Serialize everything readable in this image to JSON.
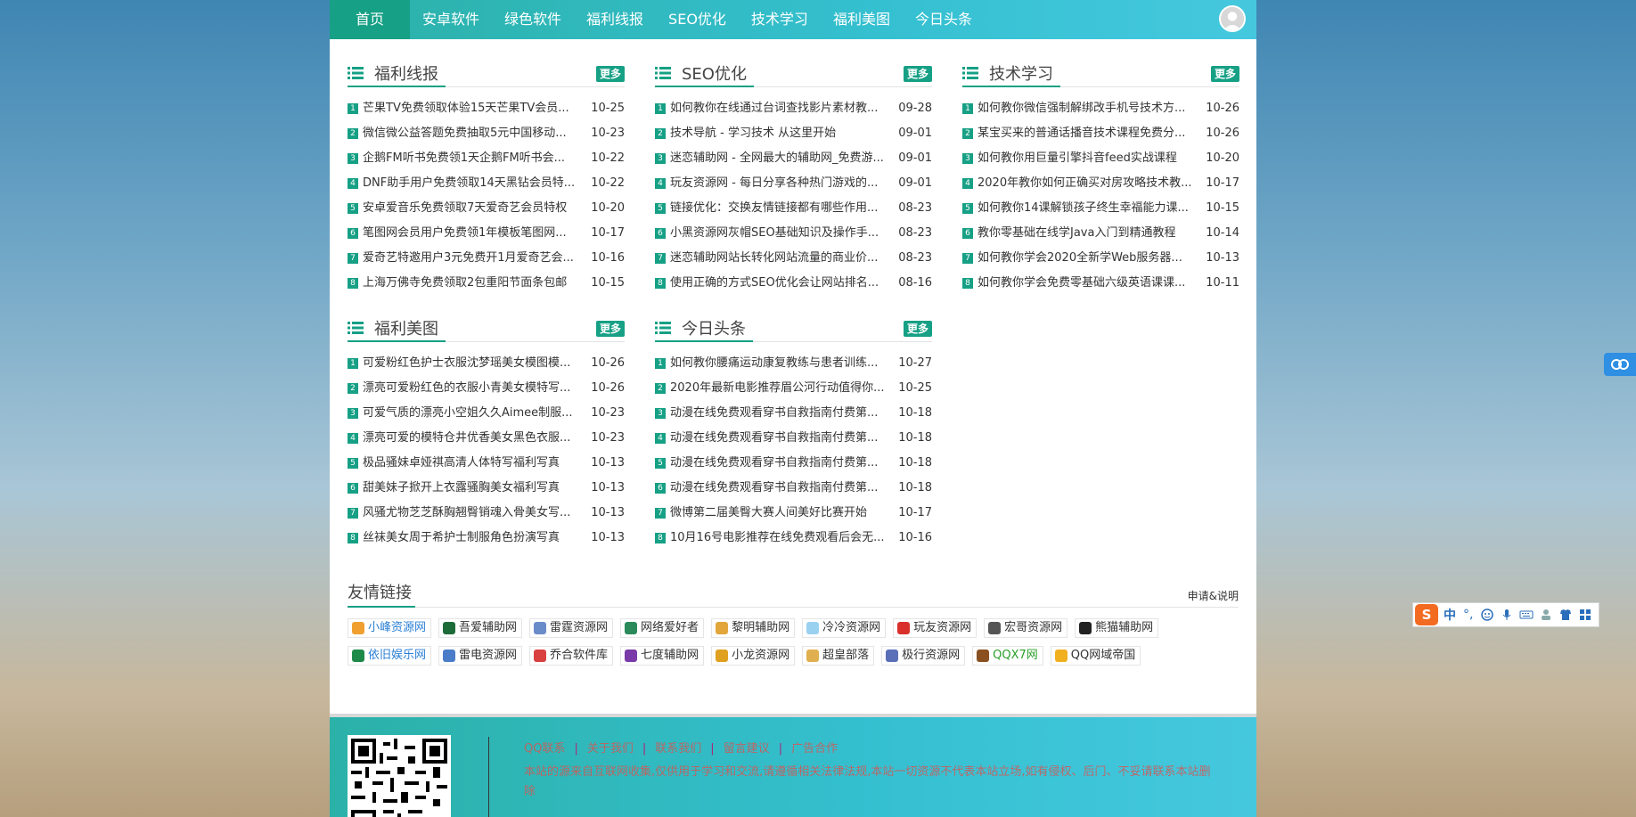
{
  "nav": {
    "items": [
      {
        "label": "首页",
        "active": true
      },
      {
        "label": "安卓软件"
      },
      {
        "label": "绿色软件"
      },
      {
        "label": "福利线报"
      },
      {
        "label": "SEO优化"
      },
      {
        "label": "技术学习"
      },
      {
        "label": "福利美图"
      },
      {
        "label": "今日头条"
      }
    ]
  },
  "blocks": [
    {
      "title": "福利线报",
      "more": "更多",
      "items": [
        {
          "n": "1",
          "title": "芒果TV免费领取体验15天芒果TV会员...",
          "date": "10-25"
        },
        {
          "n": "2",
          "title": "微信微公益答题免费抽取5元中国移动...",
          "date": "10-23"
        },
        {
          "n": "3",
          "title": "企鹅FM听书免费领1天企鹅FM听书会...",
          "date": "10-22"
        },
        {
          "n": "4",
          "title": "DNF助手用户免费领取14天黑钻会员特...",
          "date": "10-22"
        },
        {
          "n": "5",
          "title": "安卓爱音乐免费领取7天爱奇艺会员特权",
          "date": "10-20"
        },
        {
          "n": "6",
          "title": "笔图网会员用户免费领1年模板笔图网...",
          "date": "10-17"
        },
        {
          "n": "7",
          "title": "爱奇艺特邀用户3元免费开1月爱奇艺会...",
          "date": "10-16"
        },
        {
          "n": "8",
          "title": "上海万佛寺免费领取2包重阳节面条包邮",
          "date": "10-15"
        }
      ]
    },
    {
      "title": "SEO优化",
      "more": "更多",
      "items": [
        {
          "n": "1",
          "title": "如何教你在线通过台词查找影片素材教...",
          "date": "09-28"
        },
        {
          "n": "2",
          "title": "技术导航 - 学习技术 从这里开始",
          "date": "09-01"
        },
        {
          "n": "3",
          "title": "迷恋辅助网 - 全网最大的辅助网_免费游...",
          "date": "09-01"
        },
        {
          "n": "4",
          "title": "玩友资源网 - 每日分享各种热门游戏的...",
          "date": "09-01"
        },
        {
          "n": "5",
          "title": "链接优化：交换友情链接都有哪些作用...",
          "date": "08-23"
        },
        {
          "n": "6",
          "title": "小黑资源网灰帽SEO基础知识及操作手...",
          "date": "08-23"
        },
        {
          "n": "7",
          "title": "迷恋辅助网站长转化网站流量的商业价...",
          "date": "08-23"
        },
        {
          "n": "8",
          "title": "使用正确的方式SEO优化会让网站排名...",
          "date": "08-16"
        }
      ]
    },
    {
      "title": "技术学习",
      "more": "更多",
      "items": [
        {
          "n": "1",
          "title": "如何教你微信强制解绑改手机号技术方...",
          "date": "10-26"
        },
        {
          "n": "2",
          "title": "某宝买来的普通话播音技术课程免费分...",
          "date": "10-26"
        },
        {
          "n": "3",
          "title": "如何教你用巨量引擎抖音feed实战课程",
          "date": "10-20"
        },
        {
          "n": "4",
          "title": "2020年教你如何正确买对房攻略技术教...",
          "date": "10-17"
        },
        {
          "n": "5",
          "title": "如何教你14课解锁孩子终生幸福能力课...",
          "date": "10-15"
        },
        {
          "n": "6",
          "title": "教你零基础在线学Java入门到精通教程",
          "date": "10-14"
        },
        {
          "n": "7",
          "title": "如何教你学会2020全新学Web服务器...",
          "date": "10-13"
        },
        {
          "n": "8",
          "title": "如何教你学会免费零基础六级英语课课...",
          "date": "10-11"
        }
      ]
    },
    {
      "title": "福利美图",
      "more": "更多",
      "items": [
        {
          "n": "1",
          "title": "可爱粉红色护士衣服沈梦瑶美女模图模...",
          "date": "10-26"
        },
        {
          "n": "2",
          "title": "漂亮可爱粉红色的衣服小青美女模特写...",
          "date": "10-26"
        },
        {
          "n": "3",
          "title": "可爱气质的漂亮小空姐久久Aimee制服...",
          "date": "10-23"
        },
        {
          "n": "4",
          "title": "漂亮可爱的模特仓井优香美女黑色衣服...",
          "date": "10-23"
        },
        {
          "n": "5",
          "title": "极品骚妹卓娅祺高清人体特写福利写真",
          "date": "10-13"
        },
        {
          "n": "6",
          "title": "甜美妹子掀开上衣露骚胸美女福利写真",
          "date": "10-13"
        },
        {
          "n": "7",
          "title": "风骚尤物芝芝酥胸翘臀销魂入骨美女写...",
          "date": "10-13"
        },
        {
          "n": "8",
          "title": "丝袜美女周于希护士制服角色扮演写真",
          "date": "10-13"
        }
      ]
    },
    {
      "title": "今日头条",
      "more": "更多",
      "items": [
        {
          "n": "1",
          "title": "如何教你腰痛运动康复教练与患者训练...",
          "date": "10-27"
        },
        {
          "n": "2",
          "title": "2020年最新电影推荐眉公河行动值得你...",
          "date": "10-25"
        },
        {
          "n": "3",
          "title": "动漫在线免费观看穿书自救指南付费第...",
          "date": "10-18"
        },
        {
          "n": "4",
          "title": "动漫在线免费观看穿书自救指南付费第...",
          "date": "10-18"
        },
        {
          "n": "5",
          "title": "动漫在线免费观看穿书自救指南付费第...",
          "date": "10-18"
        },
        {
          "n": "6",
          "title": "动漫在线免费观看穿书自救指南付费第...",
          "date": "10-18"
        },
        {
          "n": "7",
          "title": "微博第二届美臀大赛人间美好比赛开始",
          "date": "10-17"
        },
        {
          "n": "8",
          "title": "10月16号电影推荐在线免费观看后会无...",
          "date": "10-16"
        }
      ]
    }
  ],
  "links": {
    "title": "友情链接",
    "apply": "申请&说明",
    "items": [
      {
        "label": "小峰资源网",
        "color": "#2a7fd4",
        "icon": "#f0a030"
      },
      {
        "label": "吾爱辅助网",
        "color": "#333",
        "icon": "#1e6b3a"
      },
      {
        "label": "雷霆资源网",
        "color": "#333",
        "icon": "#6a8cc8"
      },
      {
        "label": "网络爱好者",
        "color": "#333",
        "icon": "#2a8a5a"
      },
      {
        "label": "黎明辅助网",
        "color": "#333",
        "icon": "#e2a63a"
      },
      {
        "label": "冷冷资源网",
        "color": "#333",
        "icon": "#9ad0f0"
      },
      {
        "label": "玩友资源网",
        "color": "#333",
        "icon": "#d9302c"
      },
      {
        "label": "宏哥资源网",
        "color": "#333",
        "icon": "#555"
      },
      {
        "label": "熊猫辅助网",
        "color": "#333",
        "icon": "#222"
      },
      {
        "label": "依旧娱乐网",
        "color": "#2a7fd4",
        "icon": "#1e8a4a"
      },
      {
        "label": "雷电资源网",
        "color": "#333",
        "icon": "#4a7cc8"
      },
      {
        "label": "乔合软件库",
        "color": "#333",
        "icon": "#d94040"
      },
      {
        "label": "七度辅助网",
        "color": "#333",
        "icon": "#7a3aa8"
      },
      {
        "label": "小龙资源网",
        "color": "#333",
        "icon": "#e0a020"
      },
      {
        "label": "超皇部落",
        "color": "#333",
        "icon": "#e0b050"
      },
      {
        "label": "极行资源网",
        "color": "#333",
        "icon": "#5a6fb8"
      },
      {
        "label": "QQX7网",
        "color": "#2aa02a",
        "icon": "#8a5020"
      },
      {
        "label": "QQ网域帝国",
        "color": "#333",
        "icon": "#f0b020"
      }
    ]
  },
  "footer": {
    "links": [
      "QQ联系",
      "关于我们",
      "联系我们",
      "留言建议",
      "广告合作"
    ],
    "note": "本站的源来自互联网收集,仅供用于学习和交流,请遵循相关法律法规,本站一切资源不代表本站立场,如有侵权、后门、不妥请联系本站删除"
  },
  "ime": {
    "zh": "中",
    "punct": "°,"
  },
  "colors": {
    "accent": "#16a085",
    "nav": "#35c0d1"
  }
}
